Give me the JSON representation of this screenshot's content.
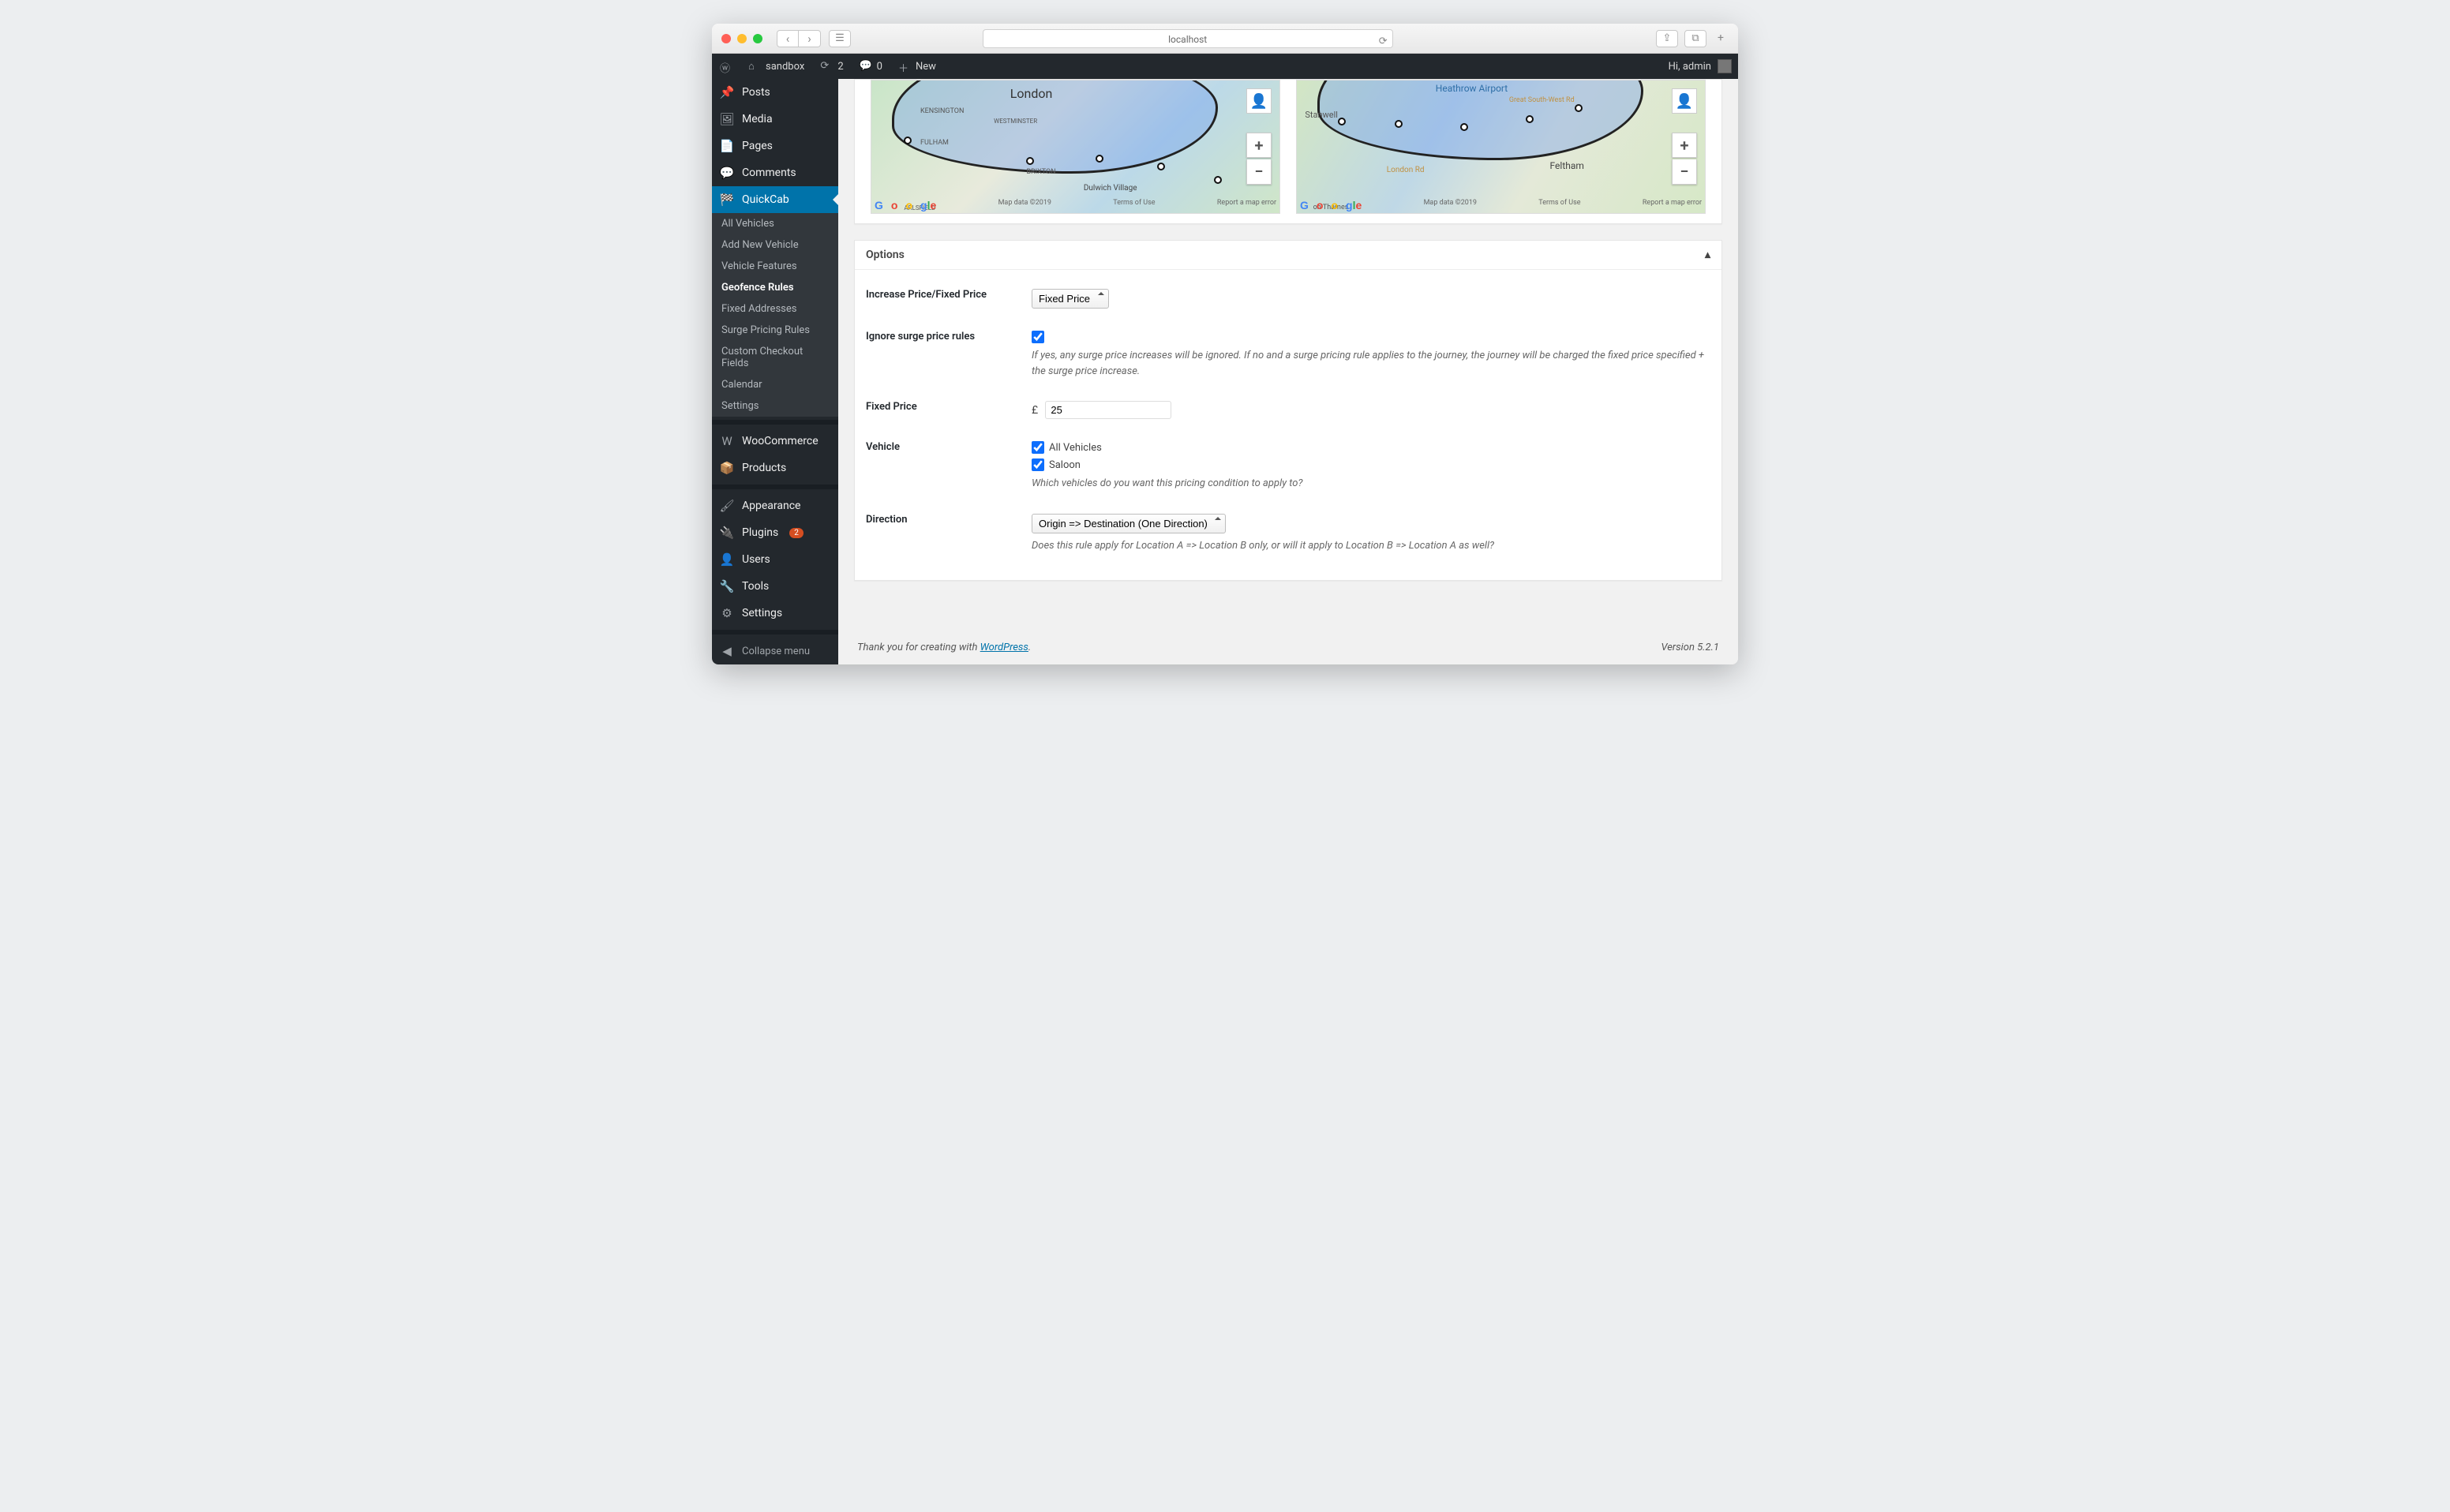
{
  "browser": {
    "url": "localhost"
  },
  "adminbar": {
    "site_name": "sandbox",
    "updates": "2",
    "comments": "0",
    "new": "New",
    "greeting": "Hi, admin"
  },
  "menu": {
    "posts": "Posts",
    "media": "Media",
    "pages": "Pages",
    "comments": "Comments",
    "quickcab": "QuickCab",
    "sub": {
      "all_vehicles": "All Vehicles",
      "add_new_vehicle": "Add New Vehicle",
      "vehicle_features": "Vehicle Features",
      "geofence_rules": "Geofence Rules",
      "fixed_addresses": "Fixed Addresses",
      "surge_pricing_rules": "Surge Pricing Rules",
      "custom_checkout_fields": "Custom Checkout Fields",
      "calendar": "Calendar",
      "settings": "Settings"
    },
    "woocommerce": "WooCommerce",
    "products": "Products",
    "appearance": "Appearance",
    "plugins": "Plugins",
    "plugins_badge": "2",
    "users": "Users",
    "tools": "Tools",
    "settings": "Settings",
    "collapse": "Collapse menu"
  },
  "maps": {
    "google_logo": "Google",
    "map1": {
      "labels": {
        "city": "London",
        "dulwich": "Dulwich Village",
        "area1": "KENSINGTON",
        "area2": "WESTMINSTER",
        "area3": "FULHAM",
        "area4": "BRIXTON",
        "area5": "ARLSFIELD"
      },
      "credit_data": "Map data ©2019",
      "credit_terms": "Terms of Use",
      "credit_error": "Report a map error"
    },
    "map2": {
      "labels": {
        "heathrow": "Heathrow Airport",
        "stanwell": "Stanwell",
        "feltham": "Feltham",
        "road": "London Rd",
        "greatsw": "Great South-West Rd",
        "thames": "on Thames"
      },
      "credit_data": "Map data ©2019",
      "credit_terms": "Terms of Use",
      "credit_error": "Report a map error"
    }
  },
  "options": {
    "heading": "Options",
    "increase_label": "Increase Price/Fixed Price",
    "increase_value": "Fixed Price",
    "ignore_label": "Ignore surge price rules",
    "ignore_checked": true,
    "ignore_desc": "If yes, any surge price increases will be ignored. If no and a surge pricing rule applies to the journey, the journey will be charged the fixed price specified + the surge price increase.",
    "fixed_label": "Fixed Price",
    "fixed_currency": "£",
    "fixed_value": "25",
    "vehicle_label": "Vehicle",
    "vehicle_all": "All Vehicles",
    "vehicle_saloon": "Saloon",
    "vehicle_desc": "Which vehicles do you want this pricing condition to apply to?",
    "direction_label": "Direction",
    "direction_value": "Origin => Destination (One Direction)",
    "direction_desc": "Does this rule apply for Location A => Location B only, or will it apply to Location B => Location A as well?"
  },
  "footer": {
    "thank_prefix": "Thank you for creating with ",
    "wordpress": "WordPress",
    "version": "Version 5.2.1"
  }
}
